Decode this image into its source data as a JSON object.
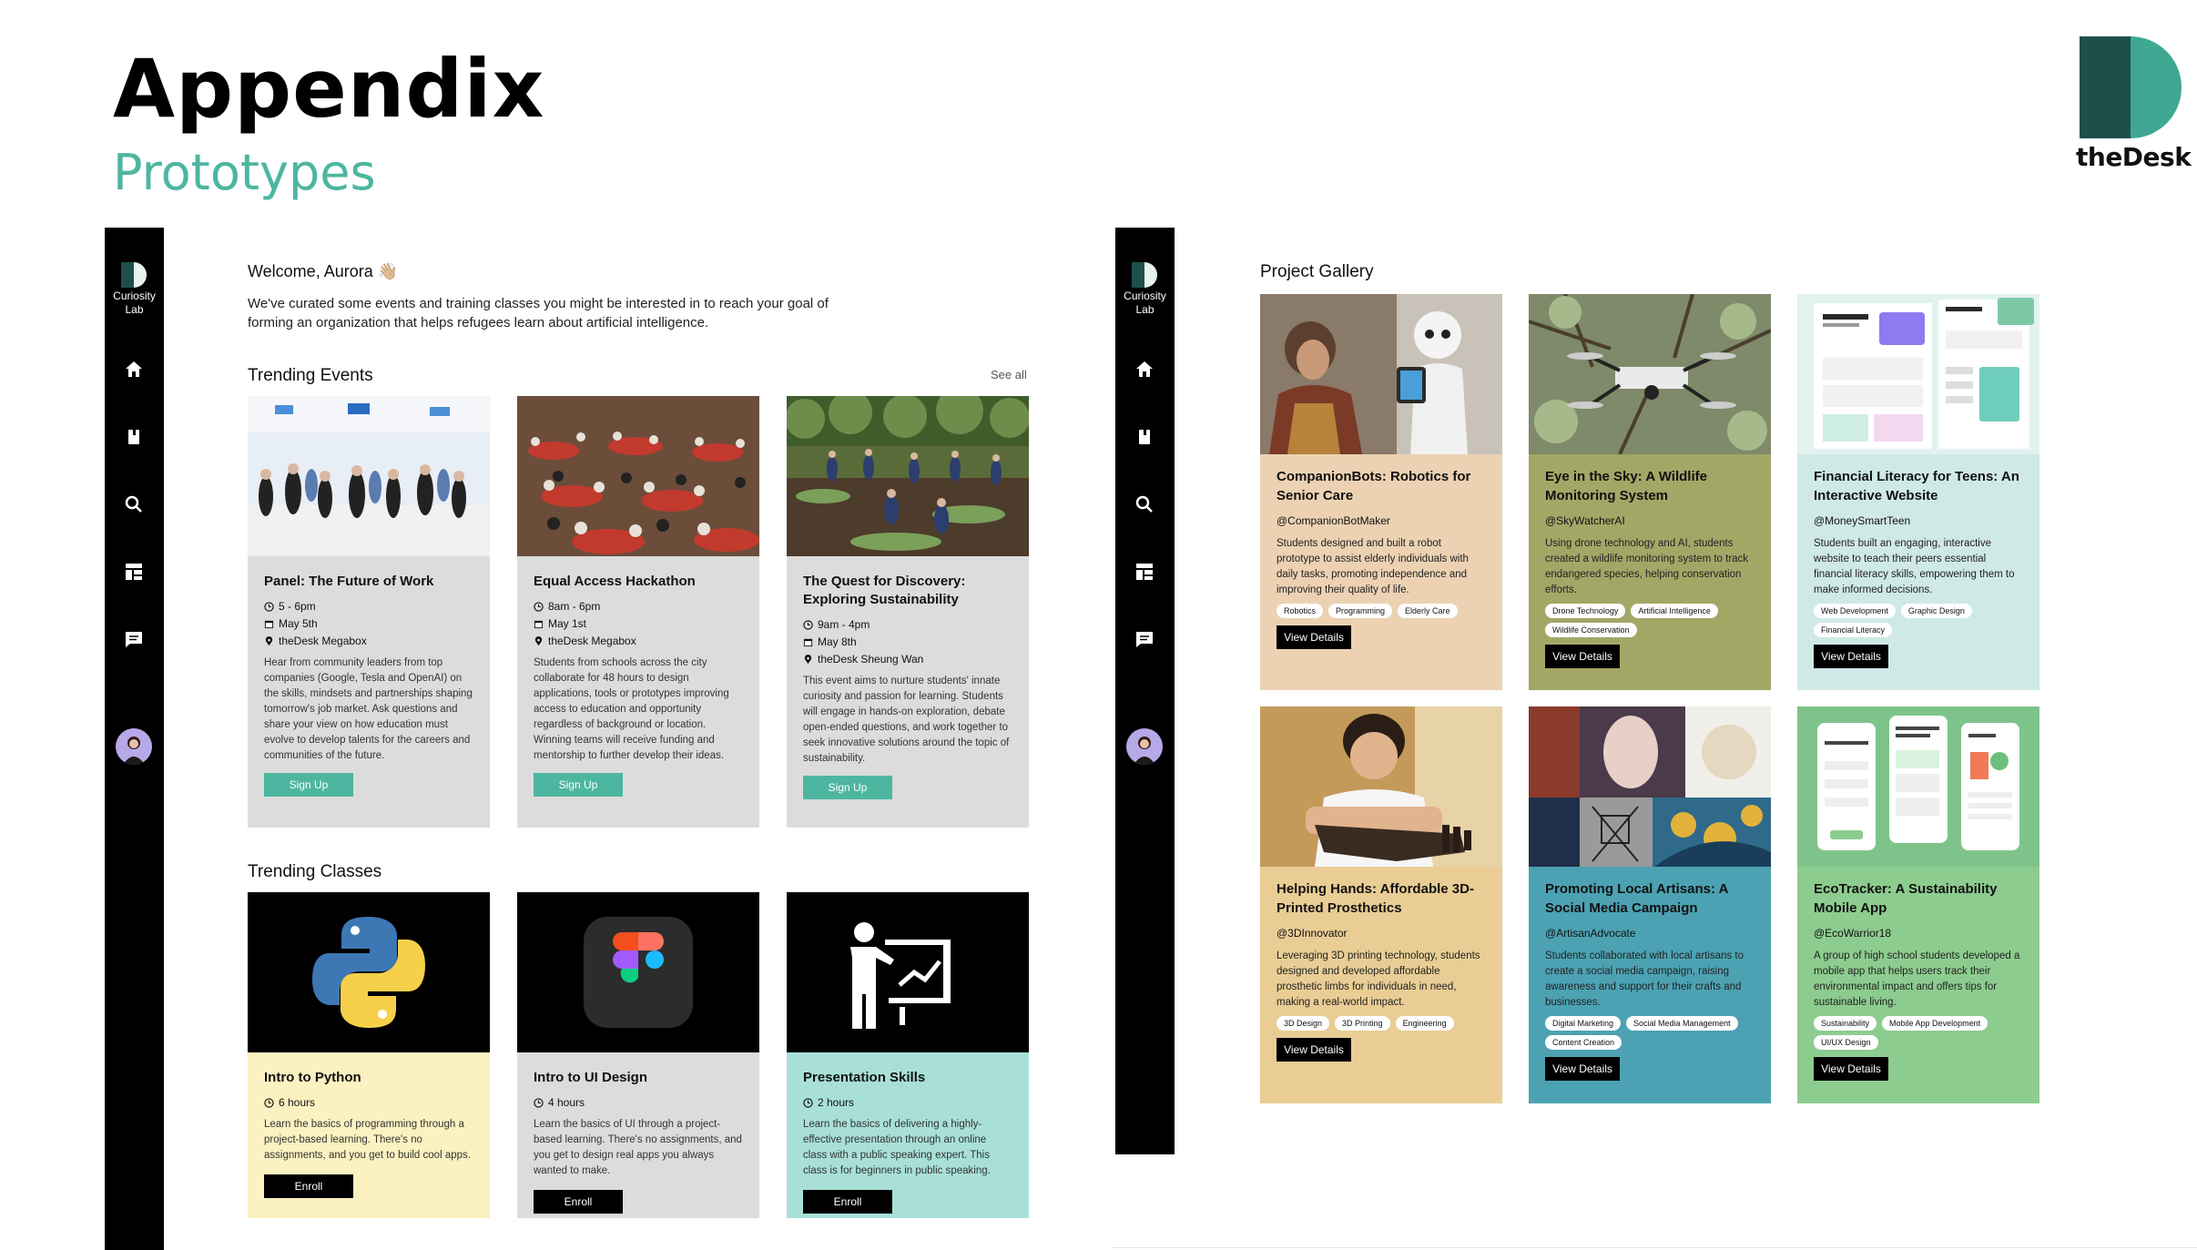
{
  "slide": {
    "title": "Appendix",
    "subtitle": "Prototypes"
  },
  "brand": {
    "name": "theDesk",
    "colors": {
      "dark": "#1f4f4a",
      "light": "#3ea893"
    }
  },
  "sidebar": {
    "logo_label_1": "Curiosity",
    "logo_label_2": "Lab",
    "nav": [
      "home-icon",
      "bookmark-icon",
      "search-icon",
      "dashboard-icon",
      "chat-icon"
    ]
  },
  "home": {
    "welcome": "Welcome, Aurora 👋🏼",
    "intro": "We've curated some events and training classes you might be interested in to reach your goal of forming an organization that helps refugees learn about artificial intelligence.",
    "events_title": "Trending Events",
    "see_all": "See all",
    "events": [
      {
        "title": "Panel: The Future of Work",
        "time": "5 - 6pm",
        "date": "May 5th",
        "place": "theDesk Megabox",
        "desc": "Hear from community leaders from top companies (Google, Tesla and OpenAI) on the skills, mindsets and partnerships shaping tomorrow's job market. Ask questions and share your view on how education must evolve to develop talents for the careers and communities of the future.",
        "button": "Sign Up"
      },
      {
        "title": "Equal Access Hackathon",
        "time": "8am - 6pm",
        "date": "May 1st",
        "place": "theDesk Megabox",
        "desc": "Students from schools across the city collaborate for 48 hours to design applications, tools or prototypes improving access to education and opportunity regardless of background or location. Winning teams will receive funding and mentorship to further develop their ideas.",
        "button": "Sign Up"
      },
      {
        "title": "The Quest for Discovery: Exploring Sustainability",
        "time": "9am - 4pm",
        "date": "May 8th",
        "place": "theDesk Sheung Wan",
        "desc": "This event aims to nurture students' innate curiosity and passion for learning. Students will engage in hands-on exploration, debate open-ended questions, and work together to seek innovative solutions around the topic of sustainability.",
        "button": "Sign Up"
      }
    ],
    "classes_title": "Trending Classes",
    "classes": [
      {
        "title": "Intro to Python",
        "duration": "6 hours",
        "desc": "Learn the basics of programming through a project-based learning. There's no assignments, and you get to build cool apps.",
        "button": "Enroll",
        "color": "#fcf1c0"
      },
      {
        "title": "Intro to UI Design",
        "duration": "4 hours",
        "desc": "Learn the basics of UI through a project-based learning. There's no assignments, and you get to design real apps you always wanted to make.",
        "button": "Enroll",
        "color": "#dcdcdc"
      },
      {
        "title": "Presentation Skills",
        "duration": "2 hours",
        "desc": "Learn the basics of delivering a highly-effective presentation through an online class with a public speaking expert. This class is for beginners in public speaking.",
        "button": "Enroll",
        "color": "#a8e0d8"
      }
    ]
  },
  "gallery": {
    "title": "Project Gallery",
    "button": "View Details",
    "projects": [
      {
        "title": "CompanionBots: Robotics for Senior Care",
        "handle": "@CompanionBotMaker",
        "desc": "Students designed and built a robot prototype to assist elderly individuals with daily tasks, promoting independence and improving their quality of life.",
        "tags": [
          "Robotics",
          "Programming",
          "Elderly Care"
        ],
        "color": "#ecd2b3"
      },
      {
        "title": "Eye in the Sky: A Wildlife Monitoring System",
        "handle": "@SkyWatcherAI",
        "desc": "Using drone technology and AI, students created a wildlife monitoring system to track endangered species, helping conservation efforts.",
        "tags": [
          "Drone Technology",
          "Artificial Intelligence",
          "Wildlife Conservation"
        ],
        "color": "#a3a766"
      },
      {
        "title": "Financial Literacy for Teens: An Interactive Website",
        "handle": "@MoneySmartTeen",
        "desc": "Students built an engaging, interactive website to teach their peers essential financial literacy skills, empowering them to make informed decisions.",
        "tags": [
          "Web Development",
          "Graphic Design",
          "Financial Literacy"
        ],
        "color": "#cfe9e7"
      },
      {
        "title": "Helping Hands: Affordable 3D-Printed Prosthetics",
        "handle": "@3DInnovator",
        "desc": "Leveraging 3D printing technology, students designed and developed affordable prosthetic limbs for individuals in need, making a real-world impact.",
        "tags": [
          "3D Design",
          "3D Printing",
          "Engineering"
        ],
        "color": "#e9cd94"
      },
      {
        "title": "Promoting Local Artisans: A Social Media Campaign",
        "handle": "@ArtisanAdvocate",
        "desc": "Students collaborated with local artisans to create a social media campaign, raising awareness and support for their crafts and businesses.",
        "tags": [
          "Digital Marketing",
          "Social Media Management",
          "Content Creation"
        ],
        "color": "#4ca2b2"
      },
      {
        "title": "EcoTracker: A Sustainability Mobile App",
        "handle": "@EcoWarrior18",
        "desc": "A group of high school students developed a mobile app that helps users track their environmental impact and offers tips for sustainable living.",
        "tags": [
          "Sustainability",
          "Mobile App Development",
          "UI/UX Design"
        ],
        "color": "#8dcc8f"
      }
    ]
  }
}
